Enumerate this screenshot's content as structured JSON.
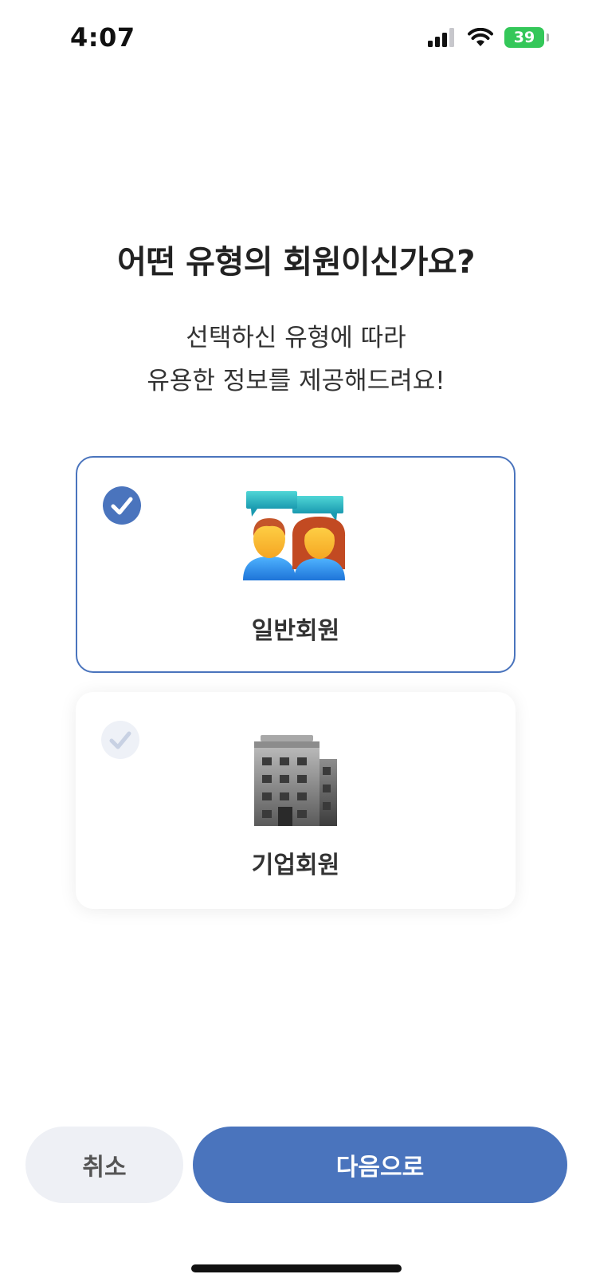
{
  "status_bar": {
    "time": "4:07",
    "battery_percent": "39"
  },
  "heading": {
    "title": "어떤 유형의 회원이신가요?",
    "subtitle_line1": "선택하신 유형에 따라",
    "subtitle_line2": "유용한 정보를 제공해드려요!"
  },
  "options": [
    {
      "label": "일반회원",
      "icon": "people-chat-icon",
      "selected": true
    },
    {
      "label": "기업회원",
      "icon": "office-building-icon",
      "selected": false
    }
  ],
  "buttons": {
    "cancel": "취소",
    "next": "다음으로"
  },
  "colors": {
    "accent": "#4a74bd",
    "check_inactive": "#eef1f7",
    "cancel_bg": "#eef0f5",
    "battery": "#34c759"
  }
}
